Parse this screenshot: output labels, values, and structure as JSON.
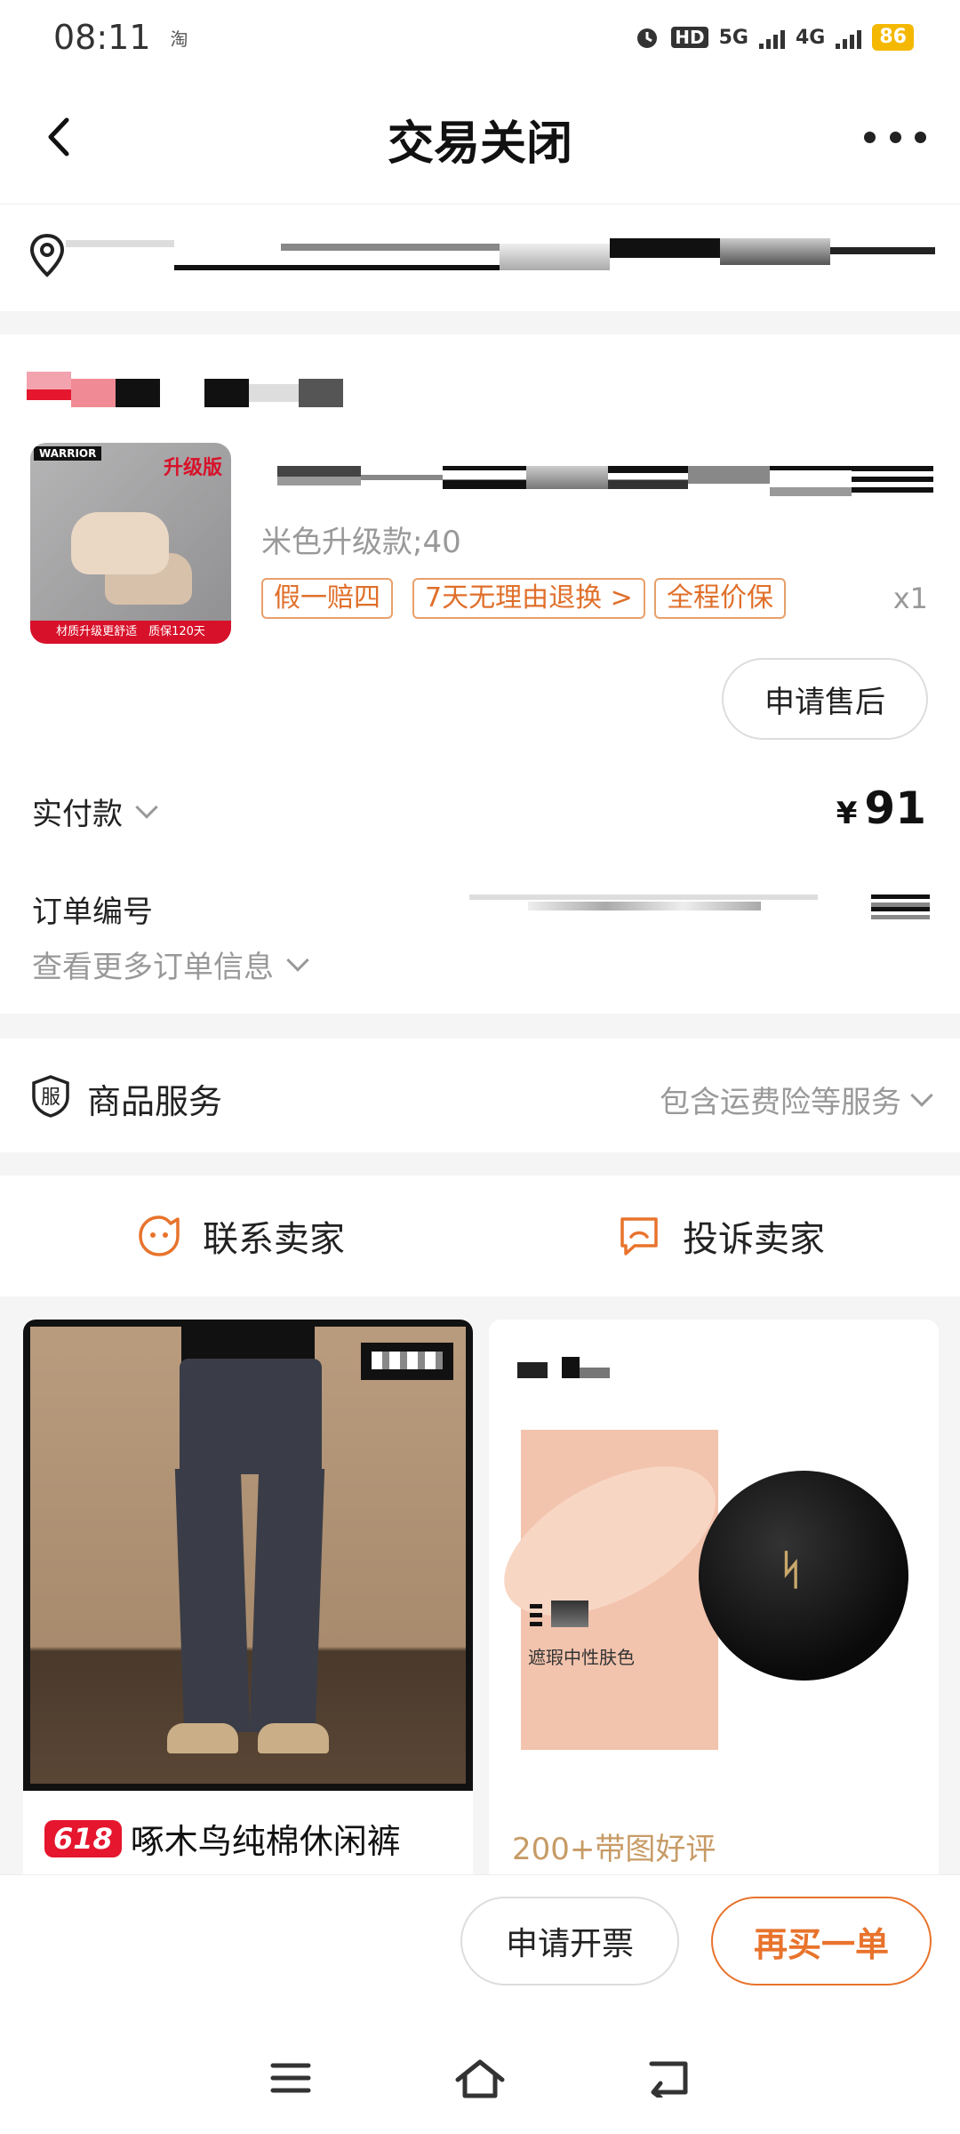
{
  "status_bar": {
    "time": "08:11",
    "app_indicator": "淘",
    "hd": "HD",
    "net1": "5G",
    "net2": "4G",
    "battery": "86"
  },
  "header": {
    "title": "交易关闭"
  },
  "order": {
    "spec": "米色升级款;40",
    "service_tags": [
      "假一赔四",
      "7天无理由退换 >",
      "全程价保"
    ],
    "quantity": "x1",
    "after_sale_label": "申请售后",
    "paid_label": "实付款",
    "currency": "¥",
    "paid_amount": "91",
    "order_no_label": "订单编号",
    "more_info_label": "查看更多订单信息",
    "product_image_text": {
      "brand": "WARRIOR",
      "upgrade": "升级版",
      "banner": "材质升级更舒适　质保120天"
    }
  },
  "service": {
    "title": "商品服务",
    "icon_char": "服",
    "desc": "包含运费险等服务"
  },
  "contact": {
    "seller_label": "联系卖家",
    "complain_label": "投诉卖家"
  },
  "recommend": {
    "left": {
      "badge": "618",
      "title": "啄木鸟纯棉休闲裤"
    },
    "right": {
      "caption": "遮瑕中性肤色",
      "review": "200+带图好评"
    }
  },
  "actions": {
    "invoice_label": "申请开票",
    "rebuy_label": "再买一单"
  },
  "colors": {
    "accent": "#e8732c",
    "tag_border": "#e8a06a",
    "muted": "#999999",
    "badge_red": "#e5162e"
  }
}
